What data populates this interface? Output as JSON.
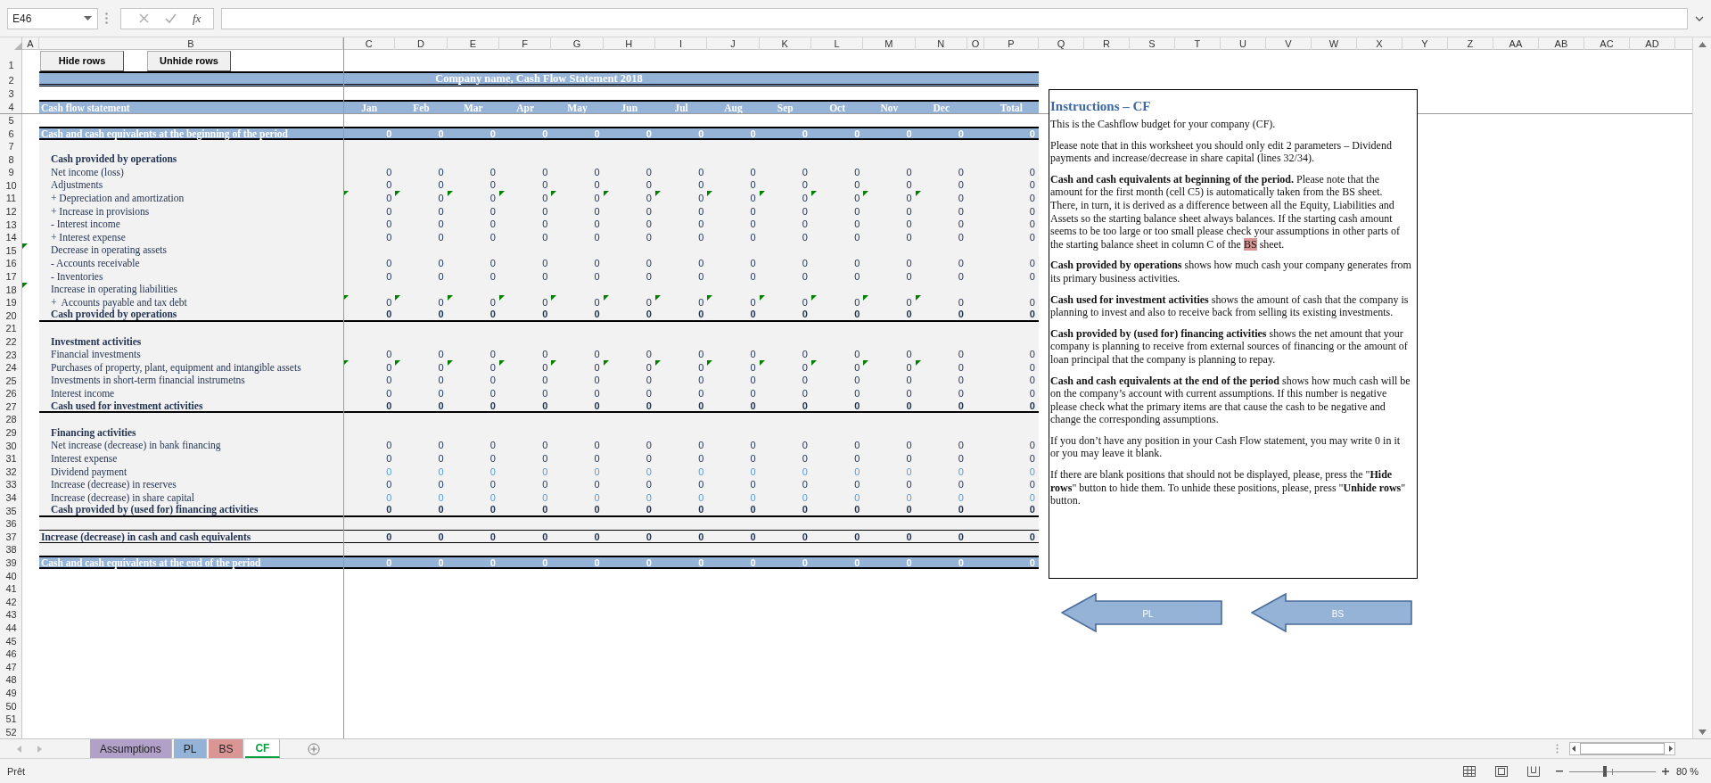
{
  "formula_bar": {
    "name_box": "E46",
    "function_label": "fx"
  },
  "sheet": {
    "column_headers": [
      "A",
      "B",
      "C",
      "D",
      "E",
      "F",
      "G",
      "H",
      "I",
      "J",
      "K",
      "L",
      "M",
      "N",
      "O",
      "P",
      "Q",
      "R",
      "S",
      "T",
      "U",
      "V",
      "W",
      "X",
      "Y",
      "Z",
      "AA",
      "AB",
      "AC",
      "AD"
    ],
    "row_headers": [
      "1",
      "2",
      "3",
      "4",
      "5",
      "6",
      "7",
      "8",
      "9",
      "10",
      "11",
      "12",
      "13",
      "14",
      "15",
      "16",
      "17",
      "18",
      "19",
      "20",
      "21",
      "22",
      "23",
      "24",
      "25",
      "26",
      "27",
      "28",
      "29",
      "30",
      "31",
      "32",
      "33",
      "34",
      "35",
      "36",
      "37",
      "38",
      "39",
      "40",
      "41",
      "42",
      "43",
      "44",
      "45",
      "46",
      "47",
      "48",
      "49",
      "50",
      "51",
      "52"
    ],
    "buttons": [
      "Hide rows",
      "Unhide rows"
    ],
    "rows": [
      {
        "kind": "title",
        "label": "Company name, Cash Flow Statement 2018"
      },
      {
        "kind": "gap"
      },
      {
        "kind": "header",
        "label": "Cash flow statement",
        "values": [
          "Jan",
          "Feb",
          "Mar",
          "Apr",
          "May",
          "Jun",
          "Jul",
          "Aug",
          "Sep",
          "Oct",
          "Nov",
          "Dec",
          "Total"
        ]
      },
      {
        "kind": "gap"
      },
      {
        "kind": "band",
        "label": "Cash and cash equivalents at the beginning of the period",
        "values": [
          "0",
          "0",
          "0",
          "0",
          "0",
          "0",
          "0",
          "0",
          "0",
          "0",
          "0",
          "0",
          "0"
        ]
      },
      {
        "kind": "shaded"
      },
      {
        "kind": "section",
        "label": "Cash provided by operations"
      },
      {
        "kind": "item",
        "label": "Net income (loss)",
        "values": [
          "0",
          "0",
          "0",
          "0",
          "0",
          "0",
          "0",
          "0",
          "0",
          "0",
          "0",
          "0",
          "0"
        ],
        "input": false,
        "flagged": false
      },
      {
        "kind": "item",
        "label": "Adjustments",
        "values": [
          "0",
          "0",
          "0",
          "0",
          "0",
          "0",
          "0",
          "0",
          "0",
          "0",
          "0",
          "0",
          "0"
        ],
        "input": false,
        "flagged": false
      },
      {
        "kind": "item",
        "label": "+ Depreciation and amortization",
        "values": [
          "0",
          "0",
          "0",
          "0",
          "0",
          "0",
          "0",
          "0",
          "0",
          "0",
          "0",
          "0",
          "0"
        ],
        "input": false,
        "flagged": true
      },
      {
        "kind": "item",
        "label": "+ Increase in provisions",
        "values": [
          "0",
          "0",
          "0",
          "0",
          "0",
          "0",
          "0",
          "0",
          "0",
          "0",
          "0",
          "0",
          "0"
        ],
        "input": false,
        "flagged": false
      },
      {
        "kind": "item",
        "label": "- Interest income",
        "values": [
          "0",
          "0",
          "0",
          "0",
          "0",
          "0",
          "0",
          "0",
          "0",
          "0",
          "0",
          "0",
          "0"
        ],
        "input": false,
        "flagged": false
      },
      {
        "kind": "item",
        "label": "+ Interest expense",
        "values": [
          "0",
          "0",
          "0",
          "0",
          "0",
          "0",
          "0",
          "0",
          "0",
          "0",
          "0",
          "0",
          "0"
        ],
        "input": false,
        "flagged": false
      },
      {
        "kind": "label",
        "label": "Decrease in operating assets",
        "flagged": true
      },
      {
        "kind": "item",
        "label": "- Accounts receivable",
        "values": [
          "0",
          "0",
          "0",
          "0",
          "0",
          "0",
          "0",
          "0",
          "0",
          "0",
          "0",
          "0",
          "0"
        ],
        "input": false,
        "flagged": false
      },
      {
        "kind": "item",
        "label": "- Inventories",
        "values": [
          "0",
          "0",
          "0",
          "0",
          "0",
          "0",
          "0",
          "0",
          "0",
          "0",
          "0",
          "0",
          "0"
        ],
        "input": false,
        "flagged": false
      },
      {
        "kind": "label",
        "label": "Increase in operating liabilities",
        "flagged": true
      },
      {
        "kind": "item",
        "label": "+  Accounts payable and tax debt",
        "values": [
          "0",
          "0",
          "0",
          "0",
          "0",
          "0",
          "0",
          "0",
          "0",
          "0",
          "0",
          "0",
          "0"
        ],
        "input": false,
        "flagged": true
      },
      {
        "kind": "subtotal",
        "label": "Cash provided by operations",
        "values": [
          "0",
          "0",
          "0",
          "0",
          "0",
          "0",
          "0",
          "0",
          "0",
          "0",
          "0",
          "0",
          "0"
        ]
      },
      {
        "kind": "shaded"
      },
      {
        "kind": "section",
        "label": "Investment activities"
      },
      {
        "kind": "item",
        "label": "Financial investments",
        "values": [
          "0",
          "0",
          "0",
          "0",
          "0",
          "0",
          "0",
          "0",
          "0",
          "0",
          "0",
          "0",
          "0"
        ],
        "input": false,
        "flagged": false
      },
      {
        "kind": "item",
        "label": "Purchases of property, plant, equipment and intangible assets",
        "values": [
          "0",
          "0",
          "0",
          "0",
          "0",
          "0",
          "0",
          "0",
          "0",
          "0",
          "0",
          "0",
          "0"
        ],
        "input": false,
        "flagged": true
      },
      {
        "kind": "item",
        "label": "Investments in short-term financial instrumetns",
        "values": [
          "0",
          "0",
          "0",
          "0",
          "0",
          "0",
          "0",
          "0",
          "0",
          "0",
          "0",
          "0",
          "0"
        ],
        "input": false,
        "flagged": false
      },
      {
        "kind": "item",
        "label": "Interest income",
        "values": [
          "0",
          "0",
          "0",
          "0",
          "0",
          "0",
          "0",
          "0",
          "0",
          "0",
          "0",
          "0",
          "0"
        ],
        "input": false,
        "flagged": false
      },
      {
        "kind": "subtotal",
        "label": "Cash used for investment activities",
        "values": [
          "0",
          "0",
          "0",
          "0",
          "0",
          "0",
          "0",
          "0",
          "0",
          "0",
          "0",
          "0",
          "0"
        ]
      },
      {
        "kind": "shaded"
      },
      {
        "kind": "section",
        "label": "Financing activities"
      },
      {
        "kind": "item",
        "label": "Net increase (decrease) in bank financing",
        "values": [
          "0",
          "0",
          "0",
          "0",
          "0",
          "0",
          "0",
          "0",
          "0",
          "0",
          "0",
          "0",
          "0"
        ],
        "input": false,
        "flagged": false
      },
      {
        "kind": "item",
        "label": "Interest expense",
        "values": [
          "0",
          "0",
          "0",
          "0",
          "0",
          "0",
          "0",
          "0",
          "0",
          "0",
          "0",
          "0",
          "0"
        ],
        "input": false,
        "flagged": false
      },
      {
        "kind": "item",
        "label": "Dividend payment",
        "values": [
          "0",
          "0",
          "0",
          "0",
          "0",
          "0",
          "0",
          "0",
          "0",
          "0",
          "0",
          "0",
          "0"
        ],
        "input": true,
        "flagged": false
      },
      {
        "kind": "item",
        "label": "Increase (decrease) in reserves",
        "values": [
          "0",
          "0",
          "0",
          "0",
          "0",
          "0",
          "0",
          "0",
          "0",
          "0",
          "0",
          "0",
          "0"
        ],
        "input": false,
        "flagged": false
      },
      {
        "kind": "item",
        "label": "Increase (decrease) in share capital",
        "values": [
          "0",
          "0",
          "0",
          "0",
          "0",
          "0",
          "0",
          "0",
          "0",
          "0",
          "0",
          "0",
          "0"
        ],
        "input": true,
        "flagged": false
      },
      {
        "kind": "subtotal",
        "label": "Cash provided by (used for) financing activities",
        "values": [
          "0",
          "0",
          "0",
          "0",
          "0",
          "0",
          "0",
          "0",
          "0",
          "0",
          "0",
          "0",
          "0"
        ]
      },
      {
        "kind": "shaded"
      },
      {
        "kind": "total",
        "label": "Increase (decrease) in cash and cash equivalents",
        "values": [
          "0",
          "0",
          "0",
          "0",
          "0",
          "0",
          "0",
          "0",
          "0",
          "0",
          "0",
          "0",
          "0"
        ]
      },
      {
        "kind": "shaded"
      },
      {
        "kind": "band",
        "label": "Cash and cash equivalents at the end of the period",
        "values": [
          "0",
          "0",
          "0",
          "0",
          "0",
          "0",
          "0",
          "0",
          "0",
          "0",
          "0",
          "0",
          "0"
        ]
      }
    ],
    "instructions": {
      "title": "Instructions – CF",
      "paragraphs": [
        {
          "text": "This is the Cashflow budget for your company (CF)."
        },
        {
          "text": "Please note that in this worksheet you should only edit 2 parameters – Dividend payments and increase/decrease in share capital (lines 32/34)."
        },
        {
          "text": "**Cash and cash equivalents at beginning of the period.** Please note that the amount for the first month (cell C5) is automatically taken from the BS sheet. There, in turn, it is derived as a difference between all the Equity, Liabilities and Assets so the starting balance sheet always balances. If the starting cash amount seems to be too large or too small please check your assumptions in other parts of the starting balance sheet in column C of the ",
          "highlight": "BS",
          "tail": " sheet."
        },
        {
          "text": "**Cash provided by operations** shows how much cash your company generates from its primary business activities."
        },
        {
          "text": "**Cash used for investment activities** shows the amount of cash that the company is planning to invest and also to receive back from selling its existing investments."
        },
        {
          "text": "**Cash provided by (used for) financing activities** shows the net amount that your company is planning to receive from external sources of financing or the amount of loan principal that the company is planning to repay."
        },
        {
          "text": "**Cash and cash equivalents at the end of the period** shows how much cash will be on the company’s account with current assumptions. If this number is negative please check what the primary items are that cause the cash to be negative and change the corresponding assumptions."
        },
        {
          "text": "If you don’t have any position in your Cash Flow statement, you may write 0 in it or you may leave it blank."
        },
        {
          "text": "If there are blank positions that should not be displayed, please, press the \"**Hide rows**\" button to hide them. To unhide these positions, please, press \"**Unhide rows**\" button."
        }
      ]
    },
    "arrow_links": [
      {
        "label": "PL"
      },
      {
        "label": "BS"
      }
    ]
  },
  "sheet_tabs": [
    {
      "label": "Assumptions",
      "color": "#b1a0c7",
      "selected": false
    },
    {
      "label": "PL",
      "color": "#95b3d7",
      "selected": false
    },
    {
      "label": "BS",
      "color": "#da9694",
      "selected": false
    },
    {
      "label": "CF",
      "color": "#00a03c",
      "selected": true
    }
  ],
  "status_bar": {
    "status": "Prêt",
    "zoom": {
      "level": 0.41,
      "reading": "80 %"
    }
  }
}
